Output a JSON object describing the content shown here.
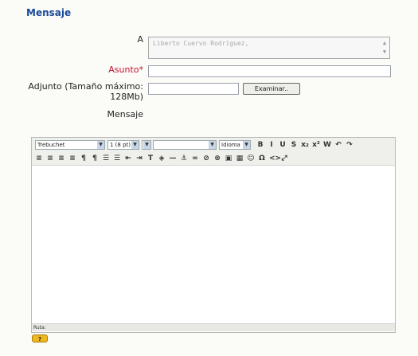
{
  "form": {
    "title": "Mensaje",
    "to_label": "A",
    "to_value": "Liberto Cuervo Rodríguez,",
    "subject_label": "Asunto",
    "subject_required_mark": "*",
    "subject_value": "",
    "attach_label_1": "Adjunto (Tamaño máximo:",
    "attach_label_2": "128Mb)",
    "attach_value": "",
    "browse_button": "Examinar..",
    "message_label": "Mensaje"
  },
  "editor": {
    "font_select": "Trebuchet",
    "size_select": "1 (8 pt)",
    "style_select": "",
    "format_select": "",
    "language_select": "Idioma",
    "toolbar_row1": [
      {
        "name": "bold-icon",
        "glyph": "B"
      },
      {
        "name": "italic-icon",
        "glyph": "I"
      },
      {
        "name": "underline-icon",
        "glyph": "U"
      },
      {
        "name": "strikethrough-icon",
        "glyph": "S"
      },
      {
        "name": "subscript-icon",
        "glyph": "x₂"
      },
      {
        "name": "superscript-icon",
        "glyph": "x²"
      },
      {
        "name": "clean-word-icon",
        "glyph": "W"
      },
      {
        "name": "undo-icon",
        "glyph": "↶"
      },
      {
        "name": "redo-icon",
        "glyph": "↷"
      }
    ],
    "toolbar_row2": [
      {
        "name": "align-left-icon",
        "glyph": "≡"
      },
      {
        "name": "align-center-icon",
        "glyph": "≡"
      },
      {
        "name": "align-right-icon",
        "glyph": "≡"
      },
      {
        "name": "justify-icon",
        "glyph": "≡"
      },
      {
        "name": "ltr-icon",
        "glyph": "¶"
      },
      {
        "name": "rtl-icon",
        "glyph": "¶"
      },
      {
        "name": "ordered-list-icon",
        "glyph": "☰"
      },
      {
        "name": "unordered-list-icon",
        "glyph": "☰"
      },
      {
        "name": "outdent-icon",
        "glyph": "⇤"
      },
      {
        "name": "indent-icon",
        "glyph": "⇥"
      },
      {
        "name": "text-color-icon",
        "glyph": "T"
      },
      {
        "name": "background-color-icon",
        "glyph": "◈"
      },
      {
        "name": "horizontal-rule-icon",
        "glyph": "—"
      },
      {
        "name": "anchor-icon",
        "glyph": "⚓"
      },
      {
        "name": "link-icon",
        "glyph": "∞"
      },
      {
        "name": "unlink-icon",
        "glyph": "⊘"
      },
      {
        "name": "no-link-icon",
        "glyph": "⊗"
      },
      {
        "name": "image-icon",
        "glyph": "▣"
      },
      {
        "name": "table-icon",
        "glyph": "▦"
      },
      {
        "name": "smiley-icon",
        "glyph": "☺"
      },
      {
        "name": "special-char-icon",
        "glyph": "Ω"
      },
      {
        "name": "html-source-icon",
        "glyph": "<>"
      },
      {
        "name": "fullscreen-icon",
        "glyph": "⤢"
      }
    ],
    "path_label": "Ruta:",
    "help_label": "?"
  }
}
